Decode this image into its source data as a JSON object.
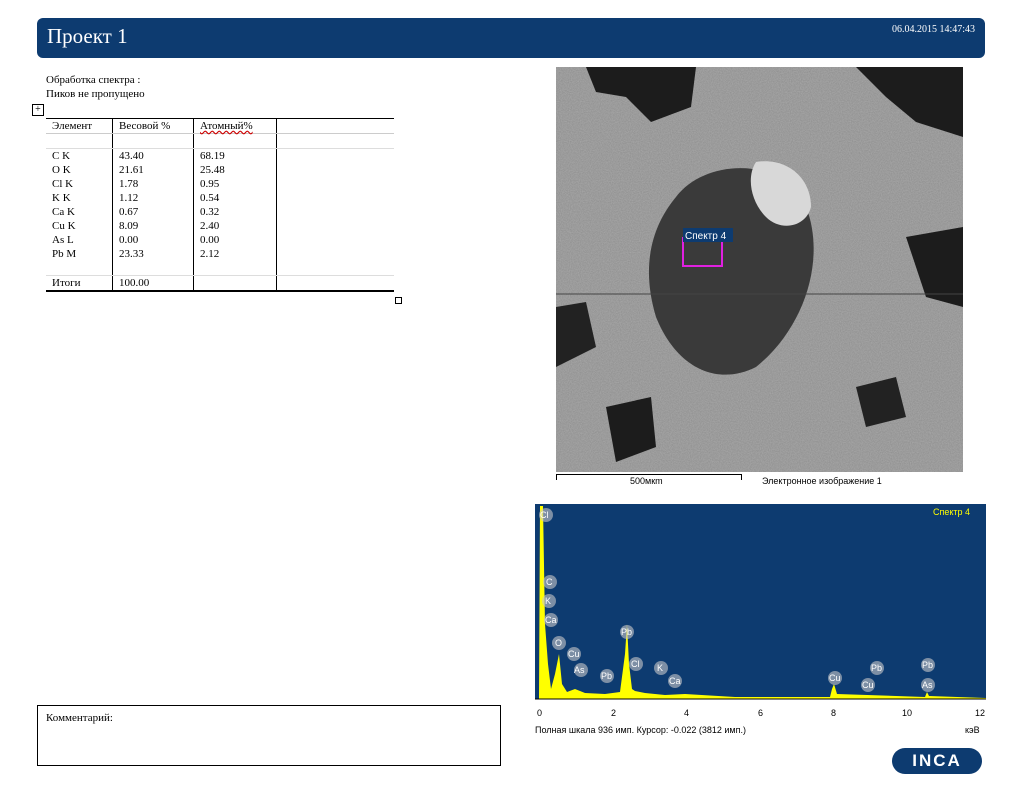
{
  "header": {
    "title": "Проект 1",
    "datetime": "06.04.2015 14:47:43"
  },
  "info": {
    "line1": "Обработка спектра :",
    "line2": "Пиков не пропущено"
  },
  "table": {
    "headers": [
      "Элемент",
      "Весовой %",
      "Атомный%",
      ""
    ],
    "rows": [
      [
        "C K",
        "43.40",
        "68.19"
      ],
      [
        "O K",
        "21.61",
        "25.48"
      ],
      [
        "Cl K",
        "1.78",
        "0.95"
      ],
      [
        "K K",
        "1.12",
        "0.54"
      ],
      [
        "Ca K",
        "0.67",
        "0.32"
      ],
      [
        "Cu K",
        "8.09",
        "2.40"
      ],
      [
        "As L",
        "0.00",
        "0.00"
      ],
      [
        "Pb M",
        "23.33",
        "2.12"
      ]
    ],
    "total": [
      "Итоги",
      "100.00"
    ]
  },
  "image": {
    "marker": "Спектр 4",
    "scale": "500мкm",
    "caption": "Электронное изображение 1"
  },
  "spectrum": {
    "title": "Спектр 4",
    "x_ticks": [
      "0",
      "2",
      "4",
      "6",
      "8",
      "10",
      "12"
    ],
    "footer": "Полная шкала 936 имп. Курсор: -0.022  (3812 имп.)",
    "unit": "кэВ",
    "peak_labels": [
      "Cl",
      "C",
      "K",
      "Ca",
      "O",
      "Cu",
      "As",
      "Pb",
      "Pb",
      "Cl",
      "K",
      "Ca",
      "Cu",
      "Cu",
      "Pb",
      "Pb",
      "As"
    ]
  },
  "comment": {
    "label": "Комментарий:"
  },
  "logo": {
    "text": "INCA"
  },
  "colors": {
    "header": "#0d3b70",
    "spectrum_bg": "#0d3b70",
    "spectrum_fill": "#ffff00",
    "marker": "#e020e0"
  }
}
